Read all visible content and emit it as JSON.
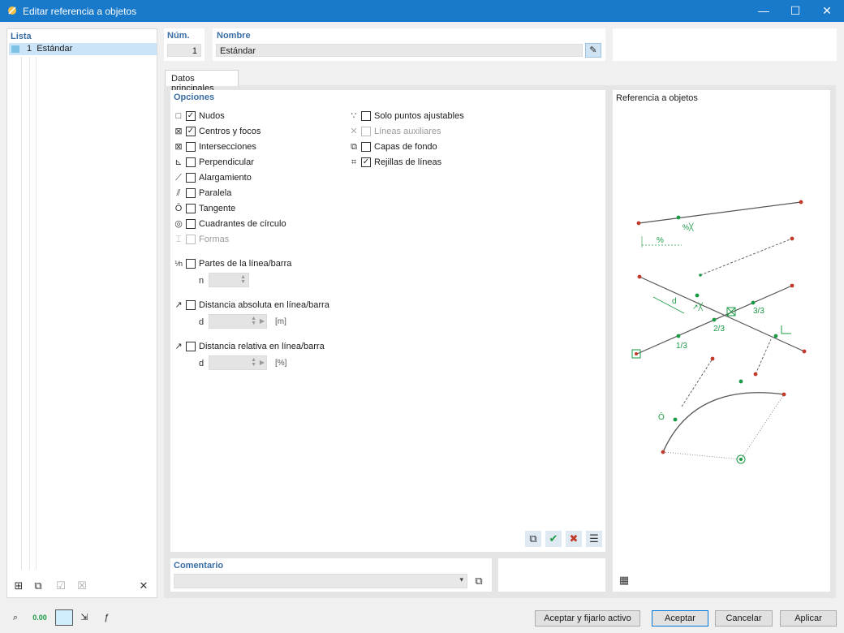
{
  "window": {
    "title": "Editar referencia a objetos",
    "minimize": "—",
    "maximize": "☐",
    "close": "✕"
  },
  "list": {
    "header": "Lista",
    "items": [
      {
        "number": "1",
        "name": "Estándar"
      }
    ]
  },
  "fields": {
    "num_label": "Núm.",
    "num_value": "1",
    "name_label": "Nombre",
    "name_value": "Estándar"
  },
  "tabs": [
    {
      "label": "Datos principales"
    }
  ],
  "options": {
    "header": "Opciones",
    "left": [
      {
        "label": "Nudos",
        "checked": true,
        "enabled": true,
        "icon": "□"
      },
      {
        "label": "Centros y focos",
        "checked": true,
        "enabled": true,
        "icon": "⊠"
      },
      {
        "label": "Intersecciones",
        "checked": false,
        "enabled": true,
        "icon": "⊠"
      },
      {
        "label": "Perpendicular",
        "checked": false,
        "enabled": true,
        "icon": "⊾"
      },
      {
        "label": "Alargamiento",
        "checked": false,
        "enabled": true,
        "icon": "⟋"
      },
      {
        "label": "Paralela",
        "checked": false,
        "enabled": true,
        "icon": "⫽"
      },
      {
        "label": "Tangente",
        "checked": false,
        "enabled": true,
        "icon": "Ō"
      },
      {
        "label": "Cuadrantes de círculo",
        "checked": false,
        "enabled": true,
        "icon": "◎"
      },
      {
        "label": "Formas",
        "checked": false,
        "enabled": false,
        "icon": "⌶"
      }
    ],
    "right": [
      {
        "label": "Solo puntos ajustables",
        "checked": false,
        "enabled": true,
        "icon": "∵"
      },
      {
        "label": "Líneas auxiliares",
        "checked": false,
        "enabled": false,
        "icon": "✕"
      },
      {
        "label": "Capas de fondo",
        "checked": false,
        "enabled": true,
        "icon": "⧉"
      },
      {
        "label": "Rejillas de líneas",
        "checked": true,
        "enabled": true,
        "icon": "⌗"
      }
    ],
    "parts": {
      "label": "Partes de la línea/barra",
      "checked": false,
      "icon": "⅟n",
      "param": "n",
      "value": ""
    },
    "absolute": {
      "label": "Distancia absoluta en línea/barra",
      "checked": false,
      "icon": "↗",
      "param": "d",
      "value": "",
      "unit": "[m]"
    },
    "relative": {
      "label": "Distancia relativa en línea/barra",
      "checked": false,
      "icon": "↗",
      "param": "d",
      "value": "",
      "unit": "[%]"
    }
  },
  "reference": {
    "header": "Referencia a objetos",
    "labels": {
      "percent": "%",
      "d": "d",
      "third1": "1/3",
      "third2": "2/3",
      "third3": "3/3"
    }
  },
  "comment": {
    "label": "Comentario",
    "value": ""
  },
  "buttons": {
    "accept_active": "Aceptar y fijarlo activo",
    "accept": "Aceptar",
    "cancel": "Cancelar",
    "apply": "Aplicar"
  },
  "bottom_icons": {
    "units": "0.00"
  },
  "colors": {
    "title_bar": "#1979ca",
    "header_text": "#3a6ea5",
    "selection": "#cce4f7",
    "green": "#1a9a45",
    "red": "#c0392b"
  }
}
